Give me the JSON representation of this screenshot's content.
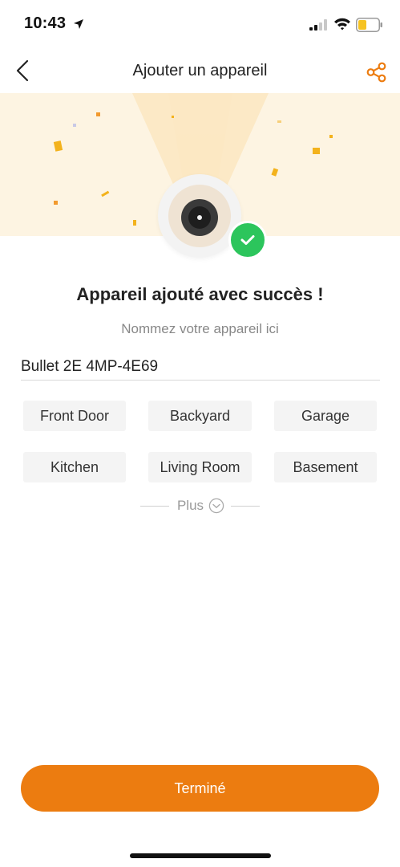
{
  "status_bar": {
    "time": "10:43",
    "icons": [
      "location-arrow-icon",
      "cellular-signal-icon",
      "wifi-icon",
      "battery-icon"
    ],
    "battery_color": "#f6c323"
  },
  "nav": {
    "title": "Ajouter un appareil",
    "back_icon": "chevron-left-icon",
    "share_icon": "share-icon",
    "accent": "#ec7c10"
  },
  "hero": {
    "device_icon": "camera-icon",
    "status_icon": "check-icon",
    "status_color": "#2cc55c"
  },
  "main": {
    "success_title": "Appareil ajouté avec succès !",
    "name_hint": "Nommez votre appareil ici",
    "device_name": "Bullet 2E 4MP-4E69",
    "suggestions": [
      "Front Door",
      "Backyard",
      "Garage",
      "Kitchen",
      "Living Room",
      "Basement"
    ],
    "more_label": "Plus",
    "more_icon": "chevron-down-circle-icon"
  },
  "footer": {
    "done_label": "Terminé",
    "done_color": "#ec7c10"
  }
}
